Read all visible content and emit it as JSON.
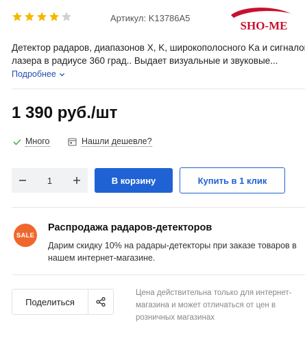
{
  "colors": {
    "star_filled": "#f5b800",
    "star_empty": "#cfcfcf",
    "accent": "#1f62d4",
    "sale": "#f0672d",
    "check": "#4caf50"
  },
  "rating": {
    "value": 4,
    "max": 5
  },
  "sku": "Артикул: K13786A5",
  "brand": {
    "logo_text": "SHO-ME"
  },
  "description": [
    "Детектор радаров, диапазонов X, K, широкополосного Ka и сигналов",
    "лазера в радиусе 360 град.. Выдает визуальные и звуковые..."
  ],
  "more_label": "Подробнее",
  "price": "1 390 руб./шт",
  "stock_label": "Много",
  "cheaper_label": "Нашли дешевле?",
  "quantity": {
    "value": "1",
    "minus_icon": "minus-icon",
    "plus_icon": "plus-icon"
  },
  "buttons": {
    "cart": "В корзину",
    "one_click": "Купить в 1 клик",
    "share": "Поделиться"
  },
  "promo": {
    "badge": "SALE",
    "title": "Распродажа радаров-детекторов",
    "text": "Дарим скидку 10% на радары-детекторы при заказе товаров в нашем интернет-магазине."
  },
  "price_note": "Цена действительна только для интернет-магазина и может отличаться от цен в розничных магазинах"
}
